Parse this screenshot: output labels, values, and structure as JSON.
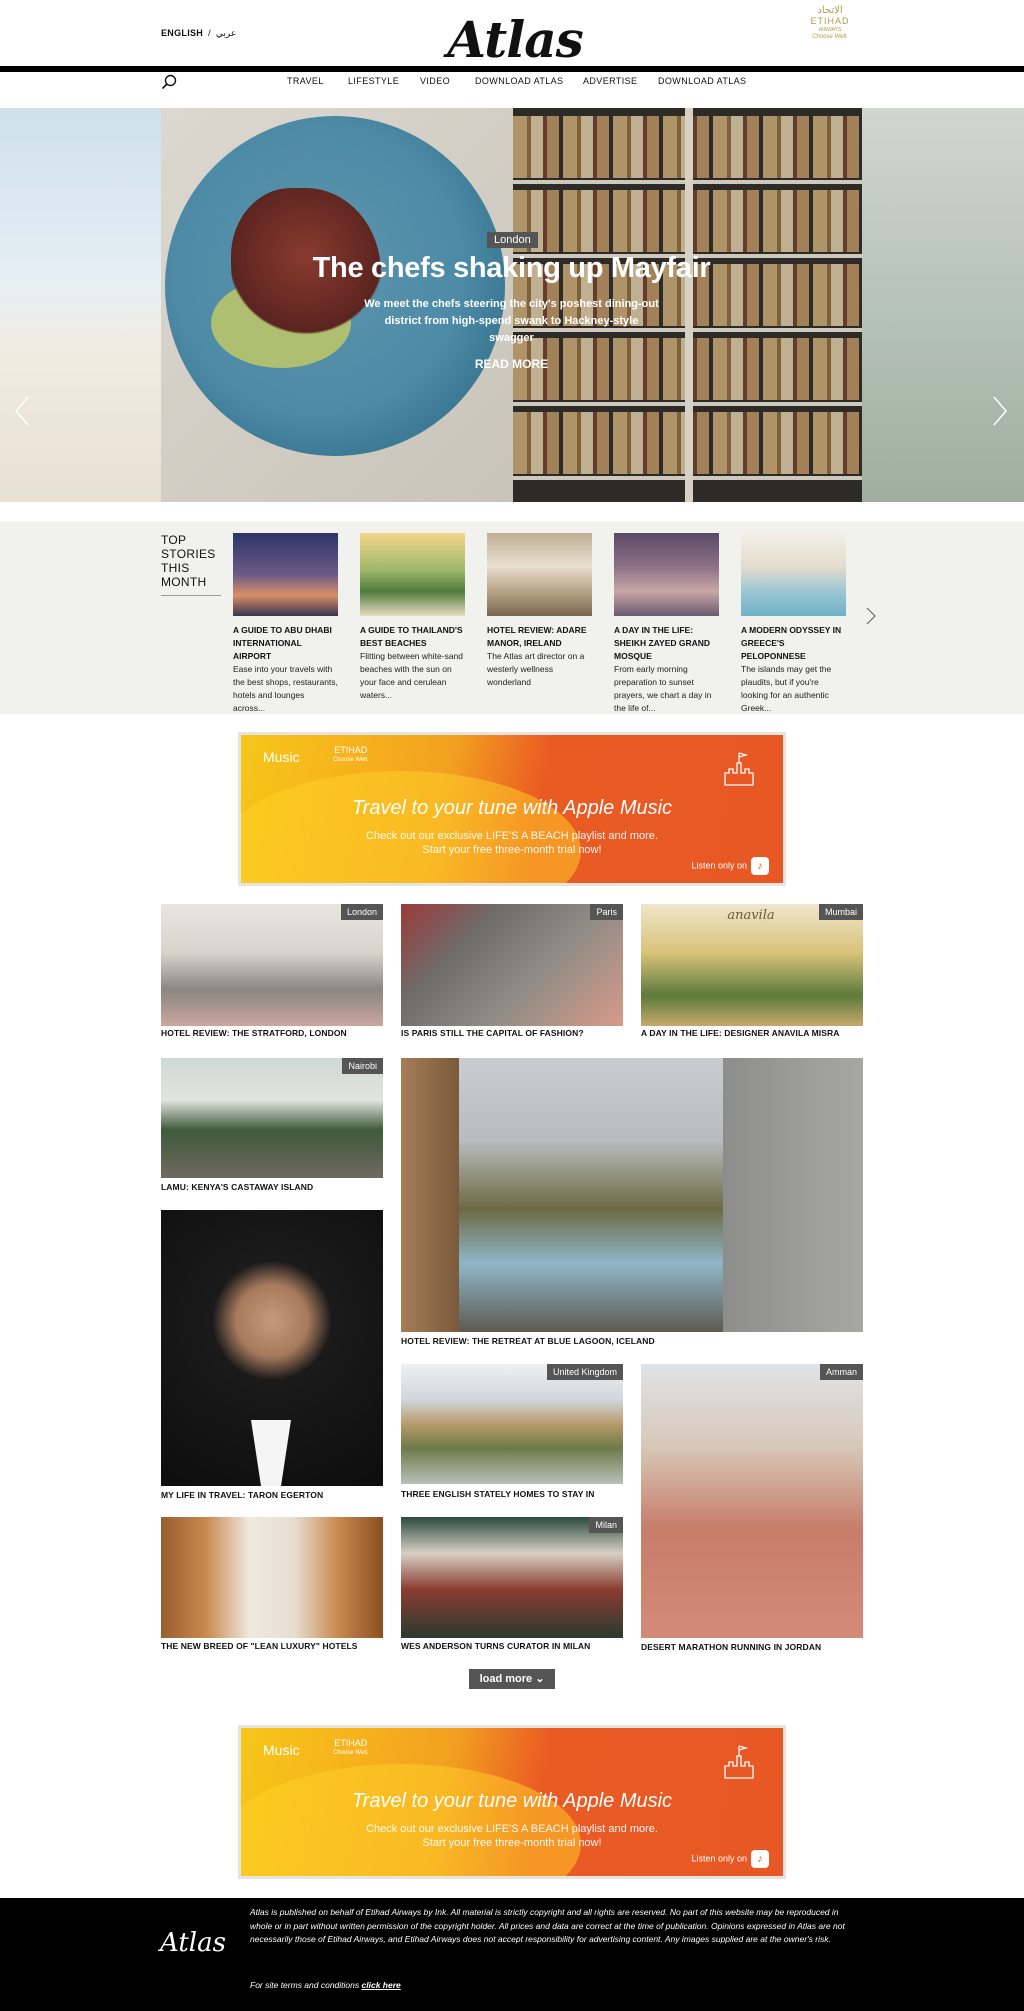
{
  "header": {
    "lang_english": "ENGLISH",
    "lang_sep": "/",
    "lang_arabic": "عربي",
    "logo": "Atlas",
    "etihad": {
      "arabic": "الاتحاد",
      "name": "ETIHAD",
      "sub": "AIRWAYS",
      "tagline": "Choose Well."
    },
    "nav": [
      "TRAVEL",
      "LIFESTYLE",
      "VIDEO",
      "DOWNLOAD ATLAS",
      "ADVERTISE",
      "DOWNLOAD ATLAS"
    ]
  },
  "hero": {
    "tag": "London",
    "title": "The chefs shaking up Mayfair",
    "subtitle": "We meet the chefs steering the city's poshest dining-out district from high-spend swank to Hackney-style swagger",
    "read_more": "READ MORE"
  },
  "top_stories": {
    "label": "TOP STORIES THIS MONTH",
    "items": [
      {
        "title": "A GUIDE TO ABU DHABI INTERNATIONAL AIRPORT",
        "desc": "Ease into your travels with the best shops, restaurants, hotels and lounges across..."
      },
      {
        "title": "A GUIDE TO THAILAND'S BEST BEACHES",
        "desc": "Flitting between white-sand beaches with the sun on your face and cerulean waters..."
      },
      {
        "title": "HOTEL REVIEW: ADARE MANOR, IRELAND",
        "desc": "The Atlas art director on a westerly wellness wonderland"
      },
      {
        "title": "A DAY IN THE LIFE: SHEIKH ZAYED GRAND MOSQUE",
        "desc": "From early morning preparation to sunset prayers, we chart a day in the life of..."
      },
      {
        "title": "A MODERN ODYSSEY IN GREECE'S PELOPONNESE",
        "desc": "The islands may get the plaudits, but if you're looking for an authentic Greek..."
      }
    ]
  },
  "ad": {
    "apple_music": "Music",
    "etihad": "ETIHAD",
    "etihad_sub": "Choose Well.",
    "headline": "Travel to your tune with Apple Music",
    "body1": "Check out our exclusive LIFE'S A BEACH playlist and more.",
    "body2": "Start your free three-month trial now!",
    "listen": "Listen only on"
  },
  "articles": [
    {
      "caption": "HOTEL REVIEW: THE STRATFORD, LONDON",
      "city": "London"
    },
    {
      "caption": "IS PARIS STILL THE CAPITAL OF FASHION?",
      "city": "Paris"
    },
    {
      "caption": "A DAY IN THE LIFE: DESIGNER ANAVILA MISRA",
      "city": "Mumbai",
      "sign": "anavila"
    },
    {
      "caption": "LAMU: KENYA'S CASTAWAY ISLAND",
      "city": "Nairobi"
    },
    {
      "caption": "HOTEL REVIEW: THE RETREAT AT BLUE LAGOON, ICELAND",
      "city": ""
    },
    {
      "caption": "MY LIFE IN TRAVEL: TARON EGERTON",
      "city": ""
    },
    {
      "caption": "THREE ENGLISH STATELY HOMES TO STAY IN",
      "city": "United Kingdom"
    },
    {
      "caption": "DESERT MARATHON RUNNING IN JORDAN",
      "city": "Amman"
    },
    {
      "caption": "THE NEW BREED OF \"LEAN LUXURY\" HOTELS",
      "city": ""
    },
    {
      "caption": "WES ANDERSON TURNS CURATOR IN MILAN",
      "city": "Milan"
    }
  ],
  "load_more": "load more",
  "footer": {
    "logo": "Atlas",
    "text": "Atlas is published on behalf of Etihad Airways by Ink. All material is strictly copyright and all rights are reserved. No part of this website may be reproduced in whole or in part without written permission of the copyright holder. All prices and data are correct at the time of publication. Opinions expressed in Atlas are not necessarily those of Etihad Airways, and Etihad Airways does not accept responsibility for advertising content. Any images supplied are at the owner's risk.",
    "terms_prefix": "For site terms and conditions",
    "terms_link": "click here"
  }
}
